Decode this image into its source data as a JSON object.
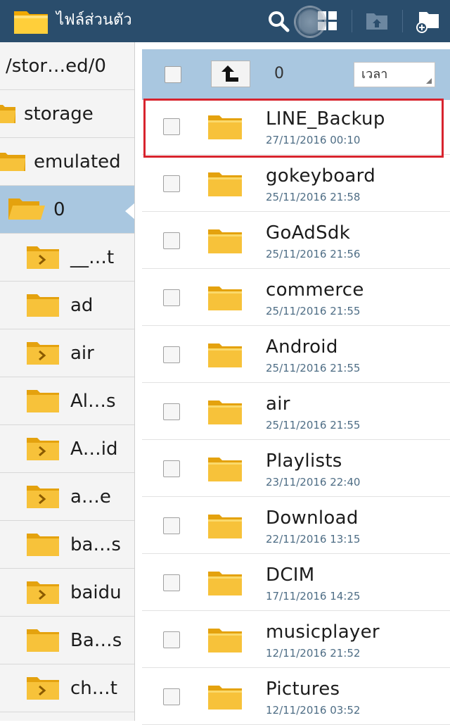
{
  "app": {
    "title": "ไฟล์ส่วนตัว"
  },
  "toolbar": {
    "icons": [
      "search-icon",
      "grid-view-icon",
      "move-to-icon",
      "new-folder-icon"
    ]
  },
  "tree": {
    "items": [
      {
        "label": "/stor…ed/0",
        "kind": "path"
      },
      {
        "label": "storage",
        "kind": "open"
      },
      {
        "label": "emulated",
        "kind": "open"
      },
      {
        "label": "0",
        "kind": "open",
        "selected": true
      },
      {
        "label": "__…t",
        "kind": "expand"
      },
      {
        "label": "ad",
        "kind": "plain"
      },
      {
        "label": "air",
        "kind": "expand"
      },
      {
        "label": "Al…s",
        "kind": "plain"
      },
      {
        "label": "A…id",
        "kind": "expand"
      },
      {
        "label": "a…e",
        "kind": "expand"
      },
      {
        "label": "ba…s",
        "kind": "plain"
      },
      {
        "label": "baidu",
        "kind": "expand"
      },
      {
        "label": "Ba…s",
        "kind": "plain"
      },
      {
        "label": "ch…t",
        "kind": "expand"
      }
    ]
  },
  "listhead": {
    "selected_count": "0",
    "sort_label": "เวลา"
  },
  "files": [
    {
      "name": "LINE_Backup",
      "date": "27/11/2016 00:10"
    },
    {
      "name": "gokeyboard",
      "date": "25/11/2016 21:58"
    },
    {
      "name": "GoAdSdk",
      "date": "25/11/2016 21:56"
    },
    {
      "name": "commerce",
      "date": "25/11/2016 21:55"
    },
    {
      "name": "Android",
      "date": "25/11/2016 21:55"
    },
    {
      "name": "air",
      "date": "25/11/2016 21:55"
    },
    {
      "name": "Playlists",
      "date": "23/11/2016 22:40"
    },
    {
      "name": "Download",
      "date": "22/11/2016 13:15"
    },
    {
      "name": "DCIM",
      "date": "17/11/2016 14:25"
    },
    {
      "name": "musicplayer",
      "date": "12/11/2016 21:52"
    },
    {
      "name": "Pictures",
      "date": "12/11/2016 03:52"
    }
  ],
  "colors": {
    "topbar": "#2a4d6c",
    "selection": "#a9c7e0",
    "folder": "#f2b81c",
    "highlight": "#d8242e"
  }
}
